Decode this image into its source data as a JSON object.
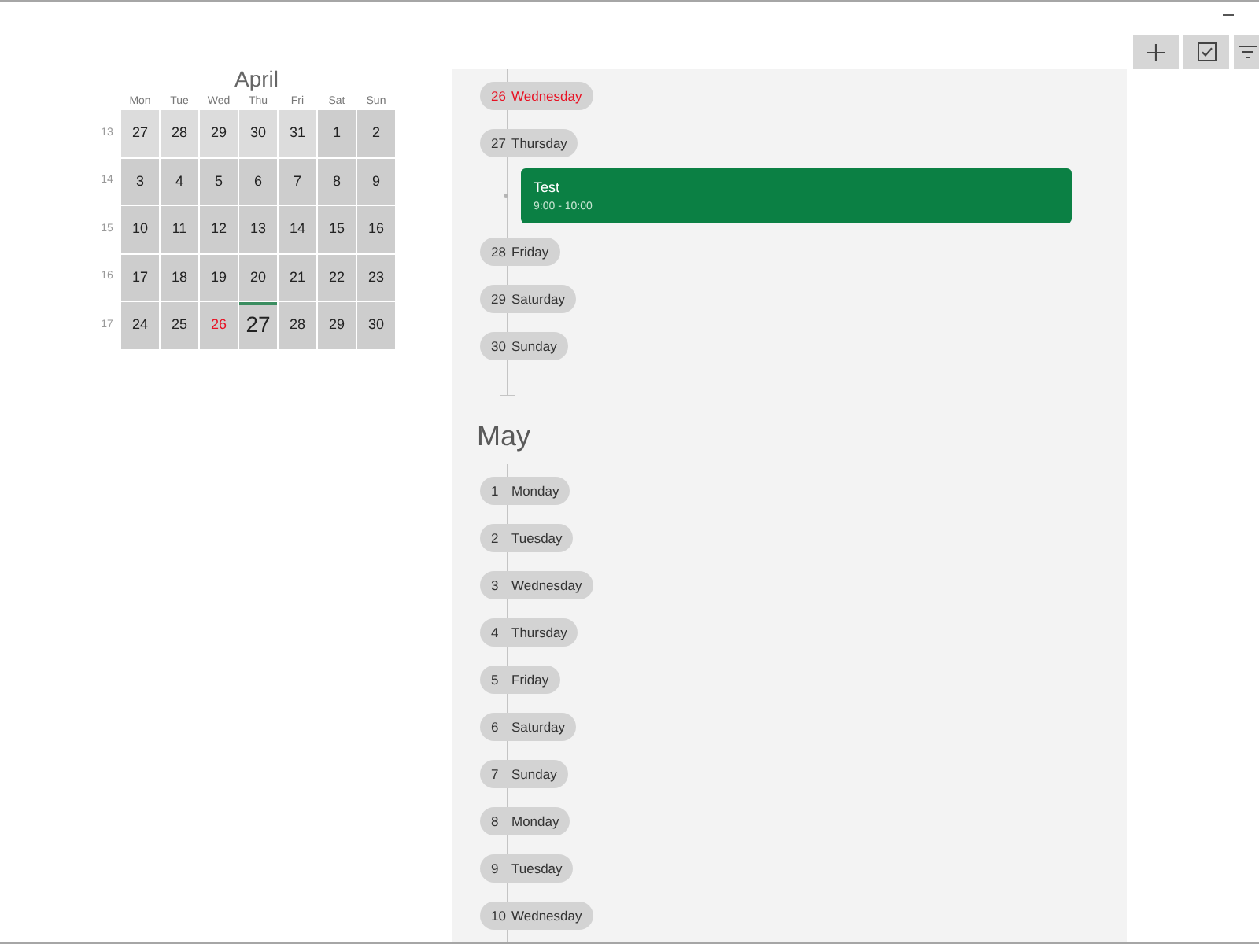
{
  "calendar": {
    "title": "April",
    "weekdays": [
      "Mon",
      "Tue",
      "Wed",
      "Thu",
      "Fri",
      "Sat",
      "Sun"
    ],
    "weeks": [
      {
        "number": "13",
        "days": [
          {
            "day": "27",
            "other_month": true,
            "today": false,
            "selected": false
          },
          {
            "day": "28",
            "other_month": true,
            "today": false,
            "selected": false
          },
          {
            "day": "29",
            "other_month": true,
            "today": false,
            "selected": false
          },
          {
            "day": "30",
            "other_month": true,
            "today": false,
            "selected": false
          },
          {
            "day": "31",
            "other_month": true,
            "today": false,
            "selected": false
          },
          {
            "day": "1",
            "other_month": false,
            "today": false,
            "selected": false
          },
          {
            "day": "2",
            "other_month": false,
            "today": false,
            "selected": false
          }
        ]
      },
      {
        "number": "14",
        "days": [
          {
            "day": "3",
            "other_month": false,
            "today": false,
            "selected": false
          },
          {
            "day": "4",
            "other_month": false,
            "today": false,
            "selected": false
          },
          {
            "day": "5",
            "other_month": false,
            "today": false,
            "selected": false
          },
          {
            "day": "6",
            "other_month": false,
            "today": false,
            "selected": false
          },
          {
            "day": "7",
            "other_month": false,
            "today": false,
            "selected": false
          },
          {
            "day": "8",
            "other_month": false,
            "today": false,
            "selected": false
          },
          {
            "day": "9",
            "other_month": false,
            "today": false,
            "selected": false
          }
        ]
      },
      {
        "number": "15",
        "days": [
          {
            "day": "10",
            "other_month": false,
            "today": false,
            "selected": false
          },
          {
            "day": "11",
            "other_month": false,
            "today": false,
            "selected": false
          },
          {
            "day": "12",
            "other_month": false,
            "today": false,
            "selected": false
          },
          {
            "day": "13",
            "other_month": false,
            "today": false,
            "selected": false
          },
          {
            "day": "14",
            "other_month": false,
            "today": false,
            "selected": false
          },
          {
            "day": "15",
            "other_month": false,
            "today": false,
            "selected": false
          },
          {
            "day": "16",
            "other_month": false,
            "today": false,
            "selected": false
          }
        ]
      },
      {
        "number": "16",
        "days": [
          {
            "day": "17",
            "other_month": false,
            "today": false,
            "selected": false
          },
          {
            "day": "18",
            "other_month": false,
            "today": false,
            "selected": false
          },
          {
            "day": "19",
            "other_month": false,
            "today": false,
            "selected": false
          },
          {
            "day": "20",
            "other_month": false,
            "today": false,
            "selected": false
          },
          {
            "day": "21",
            "other_month": false,
            "today": false,
            "selected": false
          },
          {
            "day": "22",
            "other_month": false,
            "today": false,
            "selected": false
          },
          {
            "day": "23",
            "other_month": false,
            "today": false,
            "selected": false
          }
        ]
      },
      {
        "number": "17",
        "days": [
          {
            "day": "24",
            "other_month": false,
            "today": false,
            "selected": false
          },
          {
            "day": "25",
            "other_month": false,
            "today": false,
            "selected": false
          },
          {
            "day": "26",
            "other_month": false,
            "today": true,
            "selected": false
          },
          {
            "day": "27",
            "other_month": false,
            "today": false,
            "selected": true
          },
          {
            "day": "28",
            "other_month": false,
            "today": false,
            "selected": false
          },
          {
            "day": "29",
            "other_month": false,
            "today": false,
            "selected": false
          },
          {
            "day": "30",
            "other_month": false,
            "today": false,
            "selected": false
          }
        ]
      }
    ]
  },
  "timeline": {
    "sections": [
      {
        "days": [
          {
            "day": "26",
            "weekday": "Wednesday",
            "today": true
          },
          {
            "day": "27",
            "weekday": "Thursday",
            "today": false,
            "events": [
              {
                "title": "Test",
                "time": "9:00 - 10:00",
                "color": "#0b8044"
              }
            ]
          },
          {
            "day": "28",
            "weekday": "Friday",
            "today": false
          },
          {
            "day": "29",
            "weekday": "Saturday",
            "today": false
          },
          {
            "day": "30",
            "weekday": "Sunday",
            "today": false
          }
        ]
      },
      {
        "month": "May",
        "days": [
          {
            "day": "1",
            "weekday": "Monday",
            "today": false
          },
          {
            "day": "2",
            "weekday": "Tuesday",
            "today": false
          },
          {
            "day": "3",
            "weekday": "Wednesday",
            "today": false
          },
          {
            "day": "4",
            "weekday": "Thursday",
            "today": false
          },
          {
            "day": "5",
            "weekday": "Friday",
            "today": false
          },
          {
            "day": "6",
            "weekday": "Saturday",
            "today": false
          },
          {
            "day": "7",
            "weekday": "Sunday",
            "today": false
          },
          {
            "day": "8",
            "weekday": "Monday",
            "today": false
          },
          {
            "day": "9",
            "weekday": "Tuesday",
            "today": false
          },
          {
            "day": "10",
            "weekday": "Wednesday",
            "today": false
          }
        ]
      }
    ]
  }
}
